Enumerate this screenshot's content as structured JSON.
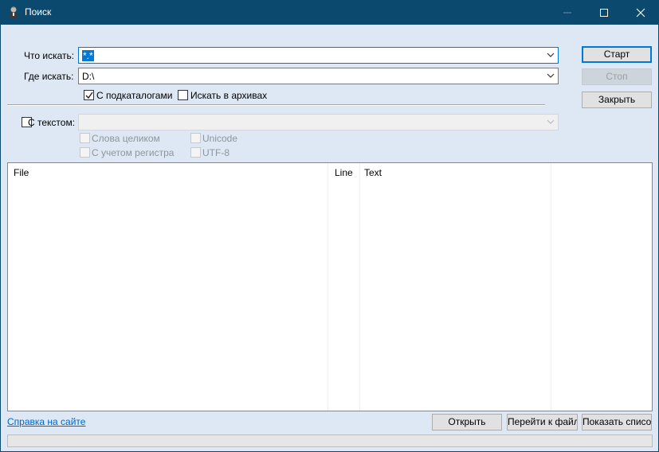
{
  "window": {
    "title": "Поиск"
  },
  "search": {
    "what_label": "Что искать:",
    "what_value": "*.*",
    "where_label": "Где искать:",
    "where_value": "D:\\",
    "subdirs_label": "С подкаталогами",
    "subdirs_checked": true,
    "archives_label": "Искать в архивах",
    "archives_checked": false,
    "text_label": "С текстом:",
    "text_checked": false,
    "text_value": "",
    "whole_words_label": "Слова целиком",
    "case_label": "С учетом регистра",
    "unicode_label": "Unicode",
    "utf8_label": "UTF-8"
  },
  "buttons": {
    "start": "Старт",
    "stop": "Стоп",
    "close": "Закрыть",
    "open": "Открыть",
    "goto_file": "Перейти к файлу",
    "show_list": "Показать список"
  },
  "results": {
    "columns": [
      "File",
      "Line",
      "Text"
    ],
    "rows": []
  },
  "footer": {
    "help_link": "Справка на сайте",
    "status": ""
  },
  "colors": {
    "titlebar": "#0b4a6e",
    "client_bg": "#dde8f4",
    "accent": "#0078d7",
    "link": "#0066cc"
  }
}
